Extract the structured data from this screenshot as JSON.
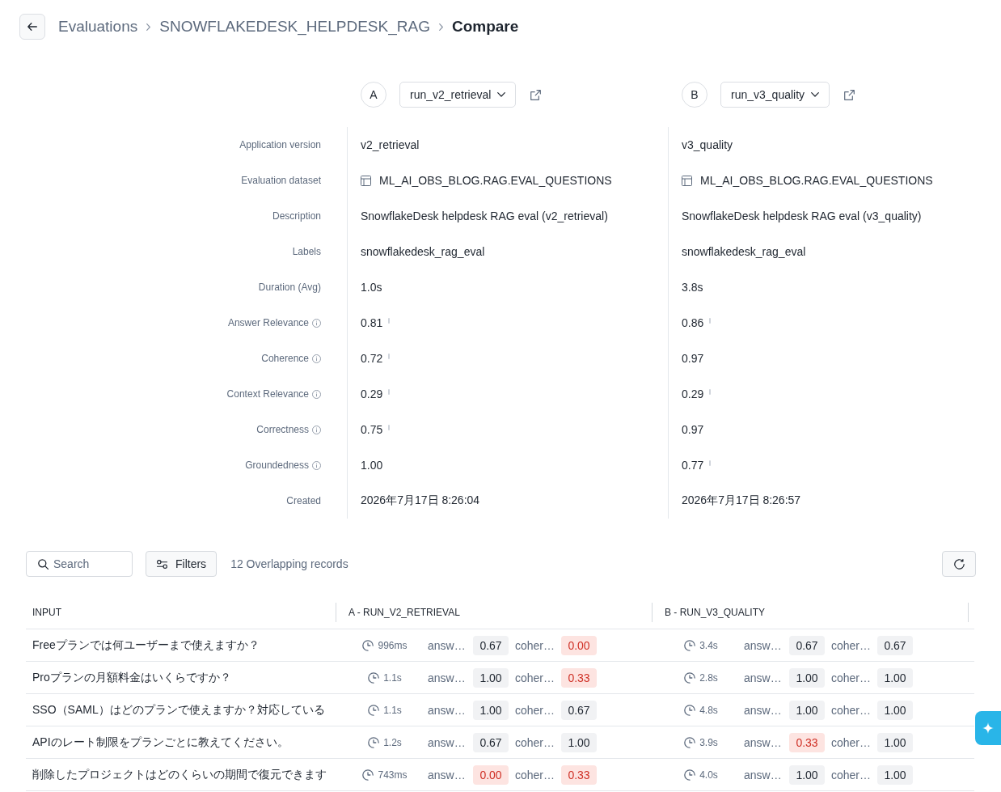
{
  "header": {
    "breadcrumb": [
      {
        "label": "Evaluations",
        "current": false
      },
      {
        "label": "SNOWFLAKEDESK_HELPDESK_RAG",
        "current": false
      },
      {
        "label": "Compare",
        "current": true
      }
    ]
  },
  "runs": [
    {
      "letter": "A",
      "name": "run_v2_retrieval"
    },
    {
      "letter": "B",
      "name": "run_v3_quality"
    }
  ],
  "details": {
    "rows": [
      {
        "label": "Application version",
        "kind": "text",
        "info": false,
        "values": [
          {
            "text": "v2_retrieval"
          },
          {
            "text": "v3_quality"
          }
        ]
      },
      {
        "label": "Evaluation dataset",
        "kind": "dataset",
        "info": false,
        "values": [
          {
            "text": "ML_AI_OBS_BLOG.RAG.EVAL_QUESTIONS"
          },
          {
            "text": "ML_AI_OBS_BLOG.RAG.EVAL_QUESTIONS"
          }
        ]
      },
      {
        "label": "Description",
        "kind": "text",
        "info": false,
        "values": [
          {
            "text": "SnowflakeDesk helpdesk RAG eval (v2_retrieval)"
          },
          {
            "text": "SnowflakeDesk helpdesk RAG eval (v3_quality)"
          }
        ]
      },
      {
        "label": "Labels",
        "kind": "text",
        "info": false,
        "values": [
          {
            "text": "snowflakedesk_rag_eval"
          },
          {
            "text": "snowflakedesk_rag_eval"
          }
        ]
      },
      {
        "label": "Duration (Avg)",
        "kind": "text",
        "info": false,
        "values": [
          {
            "text": "1.0s"
          },
          {
            "text": "3.8s"
          }
        ]
      },
      {
        "label": "Answer Relevance",
        "kind": "score",
        "info": true,
        "values": [
          {
            "text": "0.81",
            "marker": true
          },
          {
            "text": "0.86",
            "marker": true
          }
        ]
      },
      {
        "label": "Coherence",
        "kind": "score",
        "info": true,
        "values": [
          {
            "text": "0.72",
            "marker": true
          },
          {
            "text": "0.97",
            "marker": false
          }
        ]
      },
      {
        "label": "Context Relevance",
        "kind": "score",
        "info": true,
        "values": [
          {
            "text": "0.29",
            "marker": true
          },
          {
            "text": "0.29",
            "marker": true
          }
        ]
      },
      {
        "label": "Correctness",
        "kind": "score",
        "info": true,
        "values": [
          {
            "text": "0.75",
            "marker": true
          },
          {
            "text": "0.97",
            "marker": false
          }
        ]
      },
      {
        "label": "Groundedness",
        "kind": "score",
        "info": true,
        "values": [
          {
            "text": "1.00",
            "marker": false
          },
          {
            "text": "0.77",
            "marker": true
          }
        ]
      },
      {
        "label": "Created",
        "kind": "text",
        "info": false,
        "values": [
          {
            "text": "2026年7月17日 8:26:04"
          },
          {
            "text": "2026年7月17日 8:26:57"
          }
        ]
      }
    ]
  },
  "toolbar": {
    "search": {
      "placeholder": "Search"
    },
    "filters_button": "Filters",
    "record_count": "12 Overlapping records"
  },
  "table": {
    "columns": [
      "INPUT",
      "A - RUN_V2_RETRIEVAL",
      "B - RUN_V3_QUALITY"
    ],
    "rows": [
      {
        "input": "Freeプランでは何ユーザーまで使えますか？",
        "runs": [
          {
            "duration": "996ms",
            "scores": [
              {
                "label": "answ…",
                "value": "0.67",
                "flagged": false
              },
              {
                "label": "coher…",
                "value": "0.00",
                "flagged": true
              }
            ]
          },
          {
            "duration": "3.4s",
            "scores": [
              {
                "label": "answ…",
                "value": "0.67",
                "flagged": false
              },
              {
                "label": "coher…",
                "value": "0.67",
                "flagged": false
              }
            ]
          }
        ]
      },
      {
        "input": "Proプランの月額料金はいくらですか？",
        "runs": [
          {
            "duration": "1.1s",
            "scores": [
              {
                "label": "answ…",
                "value": "1.00",
                "flagged": false
              },
              {
                "label": "coher…",
                "value": "0.33",
                "flagged": true
              }
            ]
          },
          {
            "duration": "2.8s",
            "scores": [
              {
                "label": "answ…",
                "value": "1.00",
                "flagged": false
              },
              {
                "label": "coher…",
                "value": "1.00",
                "flagged": false
              }
            ]
          }
        ]
      },
      {
        "input": "SSO（SAML）はどのプランで使えますか？対応している",
        "runs": [
          {
            "duration": "1.1s",
            "scores": [
              {
                "label": "answ…",
                "value": "1.00",
                "flagged": false
              },
              {
                "label": "coher…",
                "value": "0.67",
                "flagged": false
              }
            ]
          },
          {
            "duration": "4.8s",
            "scores": [
              {
                "label": "answ…",
                "value": "1.00",
                "flagged": false
              },
              {
                "label": "coher…",
                "value": "1.00",
                "flagged": false
              }
            ]
          }
        ]
      },
      {
        "input": "APIのレート制限をプランごとに教えてください。",
        "runs": [
          {
            "duration": "1.2s",
            "scores": [
              {
                "label": "answ…",
                "value": "0.67",
                "flagged": false
              },
              {
                "label": "coher…",
                "value": "1.00",
                "flagged": false
              }
            ]
          },
          {
            "duration": "3.9s",
            "scores": [
              {
                "label": "answ…",
                "value": "0.33",
                "flagged": true
              },
              {
                "label": "coher…",
                "value": "1.00",
                "flagged": false
              }
            ]
          }
        ]
      },
      {
        "input": "削除したプロジェクトはどのくらいの期間で復元できます",
        "runs": [
          {
            "duration": "743ms",
            "scores": [
              {
                "label": "answ…",
                "value": "0.00",
                "flagged": true
              },
              {
                "label": "coher…",
                "value": "0.33",
                "flagged": true
              }
            ]
          },
          {
            "duration": "4.0s",
            "scores": [
              {
                "label": "answ…",
                "value": "1.00",
                "flagged": false
              },
              {
                "label": "coher…",
                "value": "1.00",
                "flagged": false
              }
            ]
          }
        ]
      }
    ]
  }
}
